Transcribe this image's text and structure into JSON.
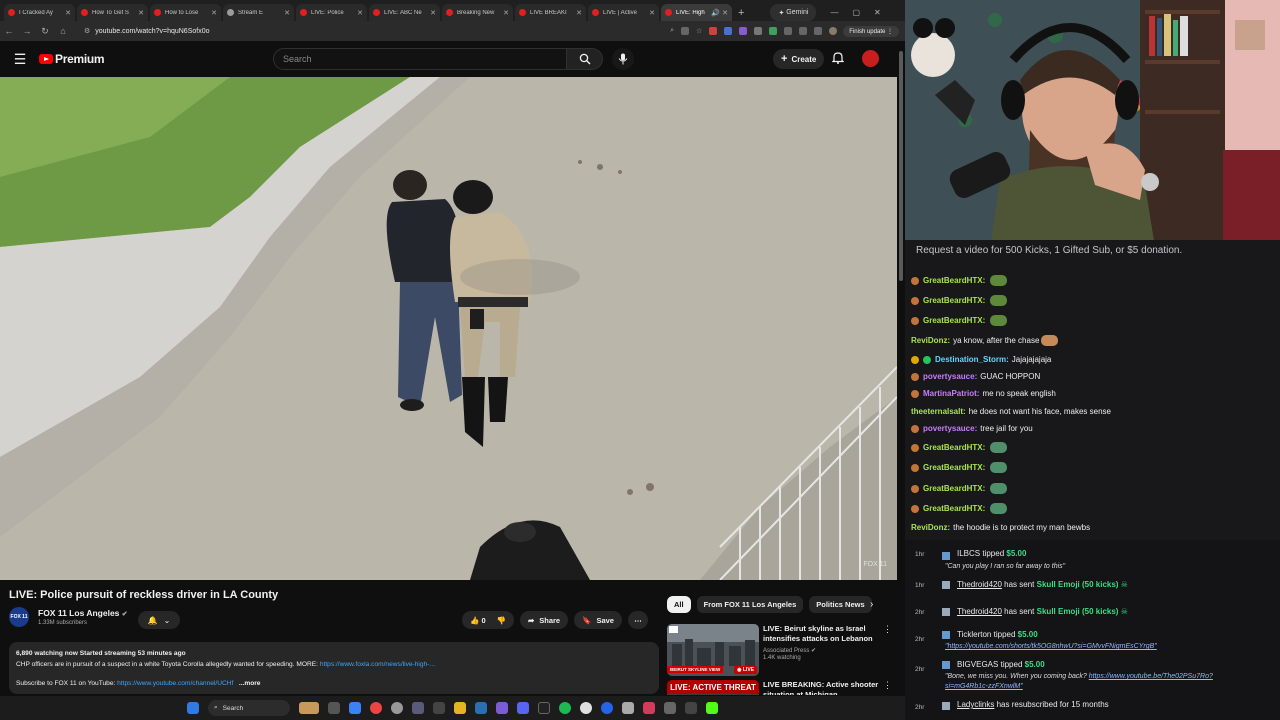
{
  "browser": {
    "tabs": [
      {
        "label": "I Cracked Ay"
      },
      {
        "label": "How To Get S"
      },
      {
        "label": "How to Lose"
      },
      {
        "label": "Stream E"
      },
      {
        "label": "LIVE: Police"
      },
      {
        "label": "LIVE: ABC Ne"
      },
      {
        "label": "Breaking New"
      },
      {
        "label": "LIVE BREAKI"
      },
      {
        "label": "LIVE | Active"
      },
      {
        "label": "LIVE: High"
      }
    ],
    "gemini_label": "Gemini",
    "url": "youtube.com/watch?v=hquN6Sofx0o",
    "finish_update": "Finish update"
  },
  "youtube": {
    "brand": "Premium",
    "search_placeholder": "Search",
    "create_label": "Create",
    "colors": {
      "brand_red": "#ff0000",
      "link": "#3ea6ff"
    }
  },
  "video": {
    "title": "LIVE: Police pursuit of reckless driver in LA County",
    "watermark": "FOX 11"
  },
  "channel": {
    "logo_text": "FOX 11",
    "name": "FOX 11 Los Angeles",
    "subscribers": "1.33M subscribers"
  },
  "actions": {
    "like_count": "0",
    "share_label": "Share",
    "save_label": "Save"
  },
  "description": {
    "stats": "6,890 watching now  Started streaming 53 minutes ago",
    "line1": "CHP officers are in pursuit of a suspect in a white Toyota Corolla allegedly wanted for speeding. MORE: ",
    "line1_link": "https://www.foxla.com/news/live-high-...",
    "line2": "Subscribe to FOX 11 on YouTube: ",
    "line2_link": "https://www.youtube.com/channel/UCHf",
    "more_label": "...more"
  },
  "recommendations": {
    "chips": [
      {
        "label": "All"
      },
      {
        "label": "From FOX 11 Los Angeles"
      },
      {
        "label": "Politics News"
      }
    ],
    "items": [
      {
        "title": "LIVE: Beirut skyline as Israel intensifies attacks on Lebanon",
        "channel": "Associated Press",
        "meta": "1.4K watching",
        "thumb_caption": "BEIRUT SKYLINE VIEW",
        "badge": "LIVE"
      },
      {
        "title": "LIVE BREAKING: Active shooter situation at Michigan",
        "thumb_caption": "LIVE: ACTIVE THREAT"
      }
    ]
  },
  "taskbar": {
    "search_label": "Search"
  },
  "chat": {
    "announcement": "Request a video for 500 Kicks, 1 Gifted Sub, or $5 donation.",
    "messages": [
      {
        "user": "GreatBeardHTX:",
        "text": "",
        "color": "#a9e34b",
        "emote": "#5c8a3a"
      },
      {
        "user": "GreatBeardHTX:",
        "text": "",
        "color": "#a9e34b",
        "emote": "#5c8a3a"
      },
      {
        "user": "GreatBeardHTX:",
        "text": "",
        "color": "#a9e34b",
        "emote": "#5c8a3a"
      },
      {
        "user": "ReviDonz:",
        "text": "ya know, after the chase",
        "color": "#a9e34b",
        "emote": "#c48a5a"
      },
      {
        "user": "Destination_Storm:",
        "text": "Jajajajajaja",
        "color": "#5fd9ff"
      },
      {
        "user": "povertysauce:",
        "text": "GUAC HOPPON",
        "color": "#c77dff"
      },
      {
        "user": "MartinaPatriot:",
        "text": "me no speak english",
        "color": "#c77dff"
      },
      {
        "user": "theeternalsalt:",
        "text": "he does not want his face, makes sense",
        "color": "#a9e34b"
      },
      {
        "user": "povertysauce:",
        "text": "tree jail for you",
        "color": "#c77dff"
      },
      {
        "user": "GreatBeardHTX:",
        "text": "",
        "color": "#a9e34b",
        "emote": "#4f8f6a"
      },
      {
        "user": "GreatBeardHTX:",
        "text": "",
        "color": "#a9e34b",
        "emote": "#4f8f6a"
      },
      {
        "user": "GreatBeardHTX:",
        "text": "",
        "color": "#a9e34b",
        "emote": "#4f8f6a"
      },
      {
        "user": "GreatBeardHTX:",
        "text": "",
        "color": "#a9e34b",
        "emote": "#4f8f6a"
      },
      {
        "user": "ReviDonz:",
        "text": "the hoodie is to protect my man bewbs",
        "color": "#a9e34b"
      }
    ]
  },
  "events": [
    {
      "age": "1hr",
      "name": "ILBCS",
      "action": "tipped",
      "amount": "$5.00",
      "message": "\"Can you play I ran so far away to this\""
    },
    {
      "age": "1hr",
      "name": "Thedroid420",
      "action": "has sent",
      "gift": "Skull Emoji (50 kicks)"
    },
    {
      "age": "2hr",
      "name": "Thedroid420",
      "action": "has sent",
      "gift": "Skull Emoji (50 kicks)"
    },
    {
      "age": "2hr",
      "name": "Ticklerton",
      "action": "tipped",
      "amount": "$5.00",
      "message_link": "\"https://youtube.com/shorts/tk5OG8nhwU?si=GMvvFNigmEsCYrgB\""
    },
    {
      "age": "2hr",
      "name": "BIGVEGAS",
      "action": "tipped",
      "amount": "$5.00",
      "message": "\"Bone, we miss you. When you coming back? ",
      "message_link": "https://www.youtube.be/The02PSu7Ro?si=mG4Rb1c-zzFXnwlM\""
    },
    {
      "age": "2hr",
      "name": "Ladyclinks",
      "action": "has resubscribed for 15 months"
    }
  ]
}
